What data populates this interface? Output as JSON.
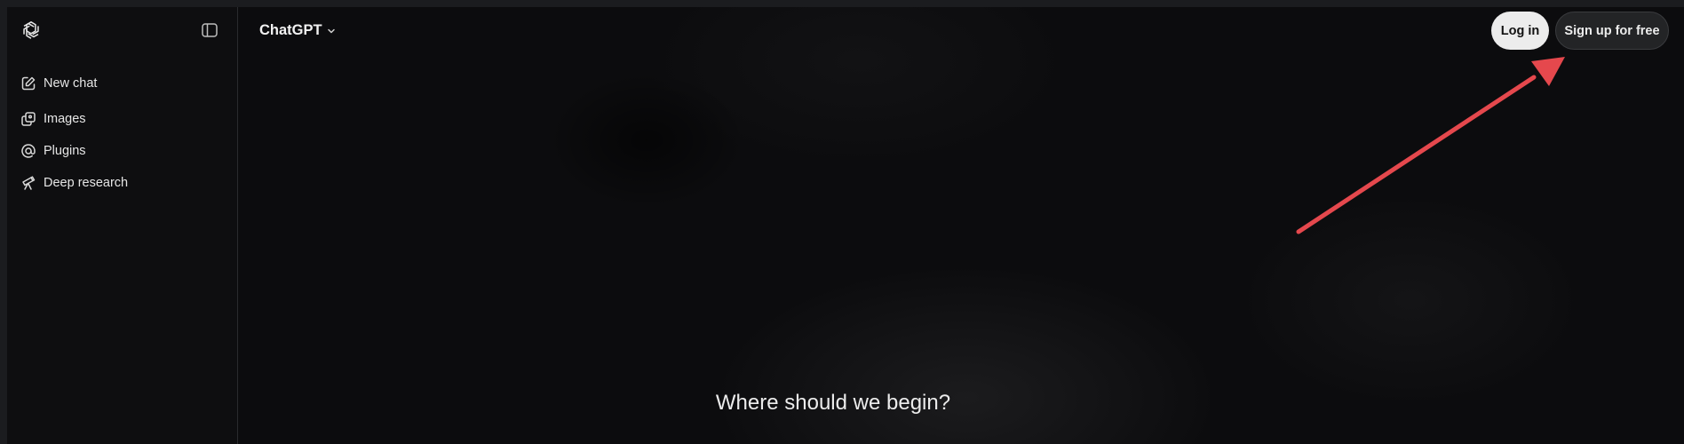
{
  "sidebar": {
    "logo_icon": "openai-logo-icon",
    "toggle_icon": "sidebar-toggle-icon",
    "items": [
      {
        "label": "New chat",
        "icon": "edit-icon"
      },
      {
        "label": "Images",
        "icon": "images-icon"
      },
      {
        "label": "Plugins",
        "icon": "at-sign-icon"
      },
      {
        "label": "Deep research",
        "icon": "telescope-icon"
      }
    ]
  },
  "header": {
    "model_label": "ChatGPT",
    "model_chevron_icon": "chevron-down-icon",
    "login_label": "Log in",
    "signup_label": "Sign up for free"
  },
  "main": {
    "heading": "Where should we begin?"
  },
  "annotation": {
    "arrow_color": "#e5484d",
    "arrow_icon": "pointer-arrow-icon"
  },
  "colors": {
    "background": "#0d0d0f",
    "login_bg": "#ececec",
    "signup_bg": "#232426",
    "text": "#ececec"
  }
}
